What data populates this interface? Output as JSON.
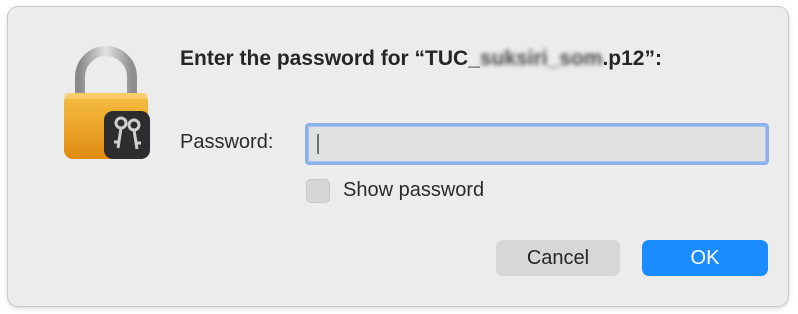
{
  "dialog": {
    "title_prefix": "Enter the password for “TUC_",
    "title_redacted": "suksiri_som",
    "title_suffix": ".p12”:",
    "password_label": "Password:",
    "password_value": "",
    "show_password_label": "Show password",
    "show_password_checked": false,
    "cancel_label": "Cancel",
    "ok_label": "OK"
  },
  "icons": {
    "app_icon": "keychain-lock-icon"
  },
  "colors": {
    "dialog_bg": "#ececec",
    "ok_button": "#1a8cff",
    "focus_ring": "#8bb0ea"
  }
}
